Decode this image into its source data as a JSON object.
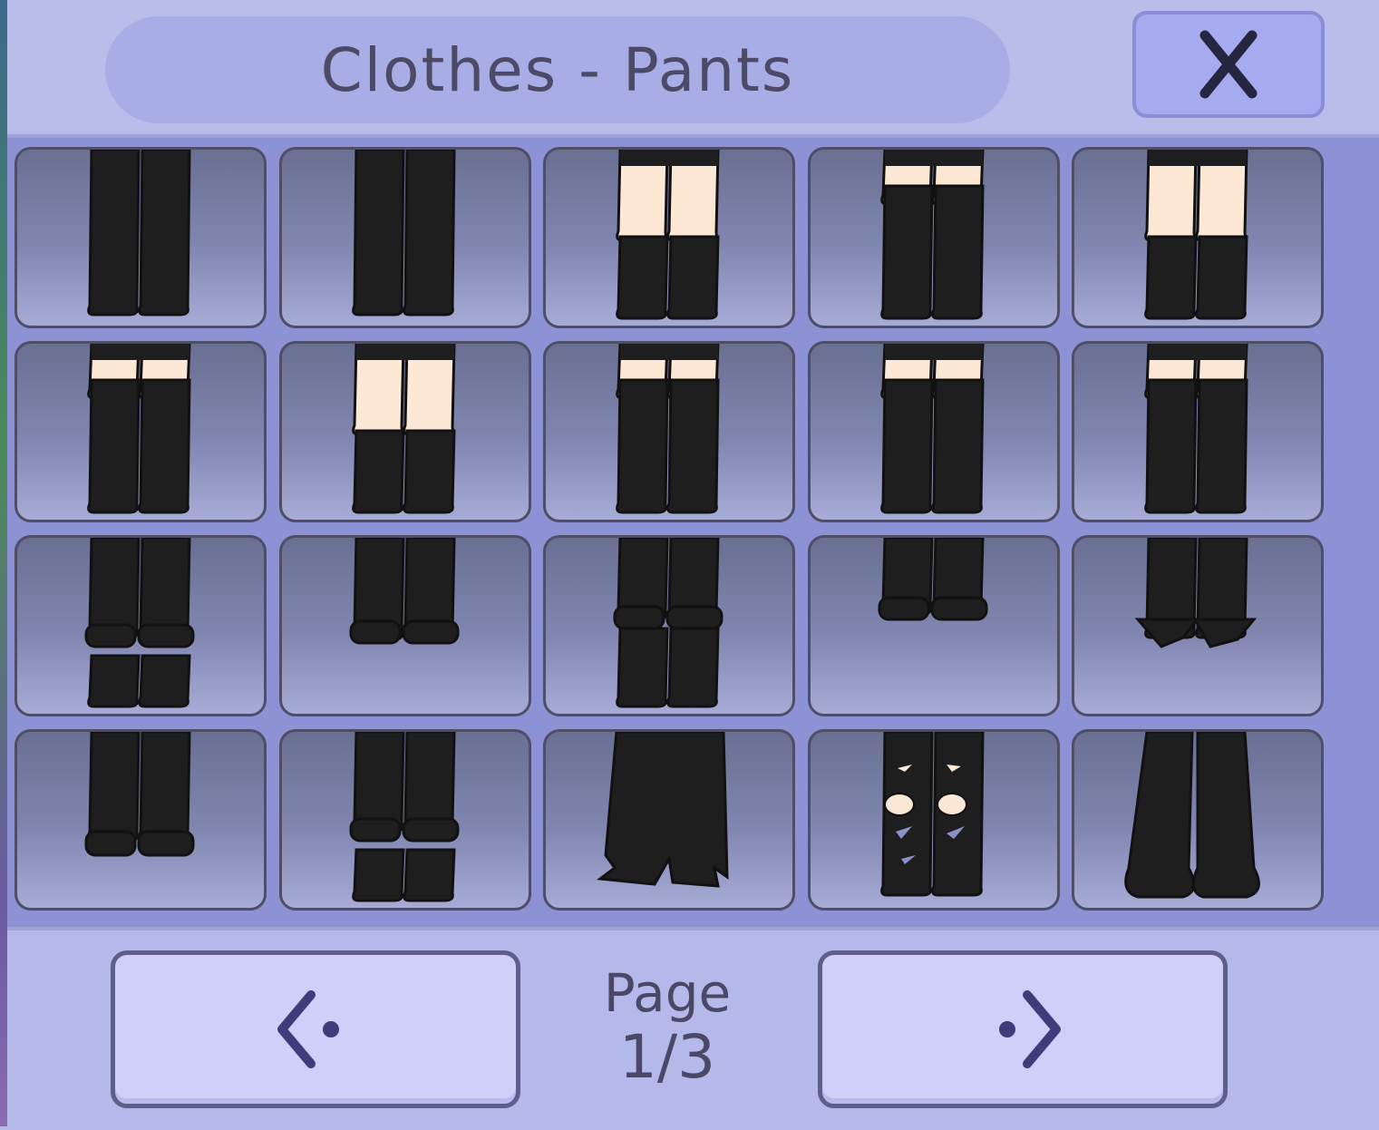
{
  "header": {
    "title": "Clothes - Pants",
    "close_label": "X"
  },
  "items": [
    {
      "id": 1,
      "style": "long-pants"
    },
    {
      "id": 2,
      "style": "long-pants"
    },
    {
      "id": 3,
      "style": "shorts-with-low-socks"
    },
    {
      "id": 4,
      "style": "shorts-with-thigh-highs"
    },
    {
      "id": 5,
      "style": "shorts-with-low-socks"
    },
    {
      "id": 6,
      "style": "shorts-with-thigh-highs"
    },
    {
      "id": 7,
      "style": "shorts-with-low-socks"
    },
    {
      "id": 8,
      "style": "shorts-with-thigh-highs"
    },
    {
      "id": 9,
      "style": "shorts-with-thigh-highs"
    },
    {
      "id": 10,
      "style": "shorts-with-thigh-highs"
    },
    {
      "id": 11,
      "style": "cuffed-pants-with-socks"
    },
    {
      "id": 12,
      "style": "cuffed-shorts"
    },
    {
      "id": 13,
      "style": "cuffed-shorts-with-socks"
    },
    {
      "id": 14,
      "style": "cuffed-short-shorts"
    },
    {
      "id": 15,
      "style": "flared-capris"
    },
    {
      "id": 16,
      "style": "baggy-cuffed-pants"
    },
    {
      "id": 17,
      "style": "cuffed-pants-with-socks"
    },
    {
      "id": 18,
      "style": "jagged-wide-pants"
    },
    {
      "id": 19,
      "style": "ripped-jeans"
    },
    {
      "id": 20,
      "style": "flared-pants"
    }
  ],
  "pagination": {
    "label": "Page",
    "current": "1/3",
    "prev_icon": "chevron-left-icon",
    "next_icon": "chevron-right-icon"
  },
  "colors": {
    "panel": "#b3b8e8",
    "grid": "#8d92d4",
    "cloth": "#1e1e1e",
    "skin": "#fde8d6",
    "outline": "#4f4e66"
  }
}
